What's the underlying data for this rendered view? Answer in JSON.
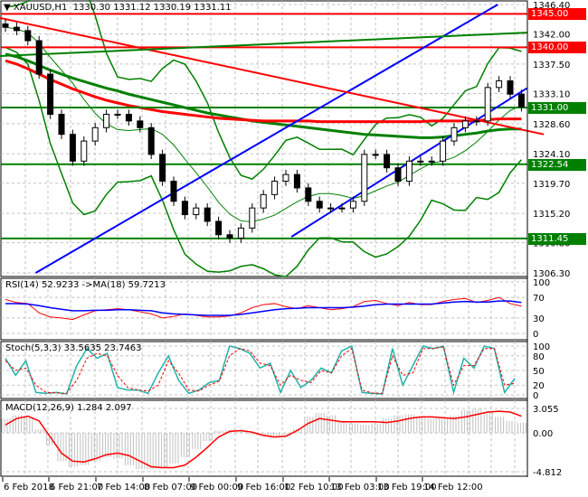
{
  "header": {
    "symbol": "XAUUSD,H1",
    "ohlc": "1330.30 1331.12 1330.19 1331.11"
  },
  "colors": {
    "bull": "#000000",
    "bear": "#000000",
    "support": "#008000",
    "resistance": "#ff0000",
    "trend": "#0000ff",
    "bands": "#008000",
    "rsi": "#ff0000",
    "rsi_ma": "#0000ff",
    "stoch_main": "#20b2aa",
    "stoch_signal": "#ff0000",
    "macd_hist": "#c0c0c0",
    "macd_signal": "#ff0000"
  },
  "chart_data": [
    {
      "type": "candlestick",
      "title": "XAUUSD,H1",
      "ylim": [
        1306.3,
        1346.4
      ],
      "yticks": [
        "1346.40",
        "1342.00",
        "1337.50",
        "1333.10",
        "1328.60",
        "1324.10",
        "1319.70",
        "1315.20",
        "1310.80",
        "1306.30"
      ],
      "closes": [
        1343,
        1342.5,
        1341,
        1336,
        1330,
        1327,
        1323,
        1326,
        1328,
        1330,
        1330,
        1329,
        1328,
        1324,
        1320,
        1317,
        1315,
        1316,
        1314,
        1312,
        1311.5,
        1313,
        1316,
        1318,
        1320,
        1321,
        1319,
        1317,
        1316,
        1316,
        1316,
        1317,
        1324,
        1324,
        1322,
        1320,
        1323,
        1323,
        1323,
        1326,
        1328,
        1329,
        1329,
        1334,
        1335,
        1333,
        1331.11
      ],
      "levels": [
        {
          "price": 1345.0,
          "label": "1345.00",
          "kind": "resistance"
        },
        {
          "price": 1340.0,
          "label": "1340.00",
          "kind": "resistance"
        },
        {
          "price": 1331.0,
          "label": "1331.00",
          "kind": "support"
        },
        {
          "price": 1322.54,
          "label": "1322.54",
          "kind": "support"
        },
        {
          "price": 1311.45,
          "label": "1311.45",
          "kind": "support"
        }
      ],
      "trendlines": [
        {
          "color": "trend",
          "p1": [
            2.7,
            1306.3
          ],
          "p2": [
            43.9,
            1346.4
          ]
        },
        {
          "color": "trend",
          "p1": [
            25.5,
            1311.7
          ],
          "p2": [
            46.5,
            1333.9
          ]
        },
        {
          "color": "resistance",
          "p1": [
            -0.5,
            1344.4
          ],
          "p2": [
            48,
            1327
          ]
        },
        {
          "color": "bands",
          "p1": [
            -0.5,
            1338.7
          ],
          "p2": [
            46.5,
            1342.2
          ]
        }
      ],
      "ma_red": [
        1338,
        1337.5,
        1336.8,
        1336,
        1335.2,
        1334.5,
        1333.8,
        1333.2,
        1332.6,
        1332.1,
        1331.7,
        1331.3,
        1331,
        1330.7,
        1330.4,
        1330.2,
        1330,
        1329.8,
        1329.6,
        1329.4,
        1329.3,
        1329.2,
        1329.1,
        1329,
        1329,
        1329,
        1329,
        1329,
        1328.9,
        1328.9,
        1328.9,
        1328.9,
        1328.9,
        1328.9,
        1328.9,
        1328.9,
        1328.9,
        1328.9,
        1329,
        1329,
        1329,
        1329,
        1329,
        1329.2,
        1329.3,
        1329.3,
        1329.3
      ],
      "ma_green": [
        1339,
        1338.6,
        1338,
        1337.3,
        1336.6,
        1336,
        1335.4,
        1334.9,
        1334.4,
        1333.9,
        1333.5,
        1333,
        1332.6,
        1332.2,
        1331.8,
        1331.4,
        1331,
        1330.6,
        1330.2,
        1329.9,
        1329.6,
        1329.3,
        1329,
        1328.8,
        1328.6,
        1328.4,
        1328.2,
        1328,
        1327.8,
        1327.6,
        1327.4,
        1327.2,
        1327,
        1326.9,
        1326.8,
        1326.7,
        1326.6,
        1326.5,
        1326.5,
        1326.6,
        1326.8,
        1327,
        1327.2,
        1327.5,
        1327.7,
        1327.8,
        1327.8
      ]
    },
    {
      "type": "line",
      "title": "RSI(14) 52.9233  ->MA(18) 59.7213",
      "ylim": [
        0,
        100
      ],
      "yticks": [
        "100",
        "70",
        "30",
        "0"
      ],
      "rsi": [
        66,
        60,
        58,
        40,
        32,
        30,
        27,
        36,
        44,
        46,
        48,
        46,
        42,
        38,
        30,
        33,
        38,
        35,
        32,
        32,
        34,
        40,
        50,
        56,
        58,
        52,
        48,
        54,
        50,
        46,
        48,
        52,
        62,
        64,
        58,
        54,
        60,
        56,
        56,
        62,
        66,
        68,
        60,
        64,
        70,
        58,
        53
      ],
      "ma": [
        58,
        58,
        57,
        54,
        50,
        47,
        44,
        44,
        45,
        45,
        46,
        46,
        45,
        44,
        40,
        38,
        37,
        36,
        35,
        35,
        35,
        37,
        40,
        43,
        46,
        48,
        49,
        50,
        50,
        50,
        50,
        51,
        53,
        56,
        57,
        57,
        57,
        57,
        57,
        59,
        61,
        62,
        61,
        61,
        63,
        63,
        60
      ]
    },
    {
      "type": "line",
      "title": "Stoch(5,3,3) 33.5635 23.7463",
      "ylim": [
        0,
        100
      ],
      "yticks": [
        "100",
        "80",
        "50",
        "20",
        "0"
      ],
      "main": [
        75,
        40,
        70,
        5,
        3,
        5,
        2,
        60,
        95,
        75,
        85,
        15,
        10,
        10,
        3,
        45,
        80,
        30,
        3,
        10,
        25,
        30,
        100,
        95,
        85,
        55,
        65,
        5,
        50,
        15,
        30,
        55,
        45,
        90,
        100,
        5,
        3,
        2,
        95,
        20,
        60,
        100,
        95,
        100,
        5,
        75,
        55,
        100,
        95,
        5,
        33.6
      ],
      "signal": [
        70,
        50,
        55,
        20,
        5,
        4,
        3,
        30,
        75,
        85,
        80,
        40,
        15,
        10,
        8,
        20,
        70,
        45,
        10,
        8,
        20,
        28,
        80,
        95,
        90,
        65,
        60,
        20,
        40,
        30,
        25,
        50,
        45,
        80,
        95,
        10,
        4,
        3,
        80,
        40,
        45,
        95,
        95,
        98,
        20,
        60,
        60,
        95,
        95,
        20,
        23.7
      ]
    },
    {
      "type": "bar+line",
      "title": "MACD(12,26,9) 1.284 2.097",
      "ylim": [
        -4.812,
        3.055
      ],
      "yticks": [
        "3.055",
        "0.00",
        "-4.812"
      ],
      "hist": [
        1.8,
        2.2,
        2,
        0.5,
        -1.5,
        -3.5,
        -4.2,
        -4,
        -3.5,
        -3,
        -3.2,
        -4,
        -4.5,
        -4.5,
        -4.3,
        -3.8,
        -3,
        -2,
        -1,
        0.3,
        0.4,
        0.3,
        -0.2,
        -0.3,
        -0.5,
        -0.4,
        0.5,
        2,
        2.5,
        2.2,
        1.5,
        1.2,
        1,
        1.2,
        1.8,
        2.2,
        2.3,
        2,
        1.8,
        1.8,
        2.2,
        2.8,
        3,
        2.6,
        2,
        1.5,
        1.284
      ],
      "signal": [
        1,
        1.8,
        2.1,
        1.5,
        -0.5,
        -2.5,
        -3.5,
        -3.6,
        -3.2,
        -2.7,
        -2.5,
        -2.8,
        -3.5,
        -4.2,
        -4.3,
        -4.3,
        -4,
        -3,
        -1.8,
        -0.5,
        0.2,
        0.3,
        0.1,
        -0.3,
        -0.5,
        -0.4,
        0.3,
        1.2,
        1.8,
        1.6,
        1.4,
        1.4,
        1.4,
        1.4,
        1.3,
        1.5,
        1.8,
        2,
        2,
        1.9,
        1.8,
        2,
        2.3,
        2.6,
        2.7,
        2.6,
        2.097
      ]
    }
  ],
  "time_axis": [
    "6 Feb 2018",
    "6 Feb 21:00",
    "7 Feb 14:00",
    "8 Feb 07:00",
    "9 Feb 00:00",
    "9 Feb 16:00",
    "12 Feb 10:00",
    "13 Feb 03:00",
    "13 Feb 19:00",
    "14 Feb 12:00"
  ]
}
